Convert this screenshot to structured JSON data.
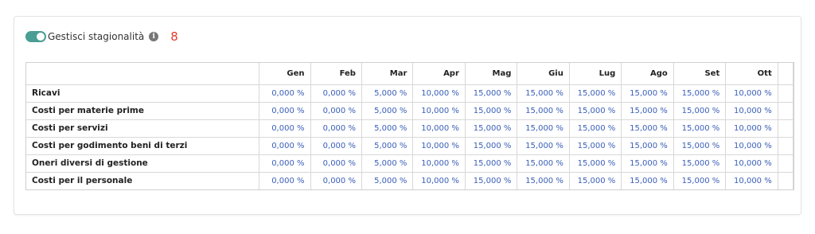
{
  "toggle": {
    "label": "Gestisci stagionalità",
    "enabled": true,
    "info_icon": "info-icon",
    "count": "8"
  },
  "table": {
    "columns": [
      "",
      "Gen",
      "Feb",
      "Mar",
      "Apr",
      "Mag",
      "Giu",
      "Lug",
      "Ago",
      "Set",
      "Ott"
    ],
    "rows": [
      {
        "label": "Ricavi",
        "values": [
          "0,000 %",
          "0,000 %",
          "5,000 %",
          "10,000 %",
          "15,000 %",
          "15,000 %",
          "15,000 %",
          "15,000 %",
          "15,000 %",
          "10,000 %"
        ]
      },
      {
        "label": "Costi per materie prime",
        "values": [
          "0,000 %",
          "0,000 %",
          "5,000 %",
          "10,000 %",
          "15,000 %",
          "15,000 %",
          "15,000 %",
          "15,000 %",
          "15,000 %",
          "10,000 %"
        ]
      },
      {
        "label": "Costi per servizi",
        "values": [
          "0,000 %",
          "0,000 %",
          "5,000 %",
          "10,000 %",
          "15,000 %",
          "15,000 %",
          "15,000 %",
          "15,000 %",
          "15,000 %",
          "10,000 %"
        ]
      },
      {
        "label": "Costi per godimento beni di terzi",
        "values": [
          "0,000 %",
          "0,000 %",
          "5,000 %",
          "10,000 %",
          "15,000 %",
          "15,000 %",
          "15,000 %",
          "15,000 %",
          "15,000 %",
          "10,000 %"
        ]
      },
      {
        "label": "Oneri diversi di gestione",
        "values": [
          "0,000 %",
          "0,000 %",
          "5,000 %",
          "10,000 %",
          "15,000 %",
          "15,000 %",
          "15,000 %",
          "15,000 %",
          "15,000 %",
          "10,000 %"
        ]
      },
      {
        "label": "Costi per il personale",
        "values": [
          "0,000 %",
          "0,000 %",
          "5,000 %",
          "10,000 %",
          "15,000 %",
          "15,000 %",
          "15,000 %",
          "15,000 %",
          "15,000 %",
          "10,000 %"
        ]
      }
    ]
  },
  "colors": {
    "accent": "#4a9e93",
    "value_text": "#3a5fb8",
    "badge": "#e23b2e"
  }
}
